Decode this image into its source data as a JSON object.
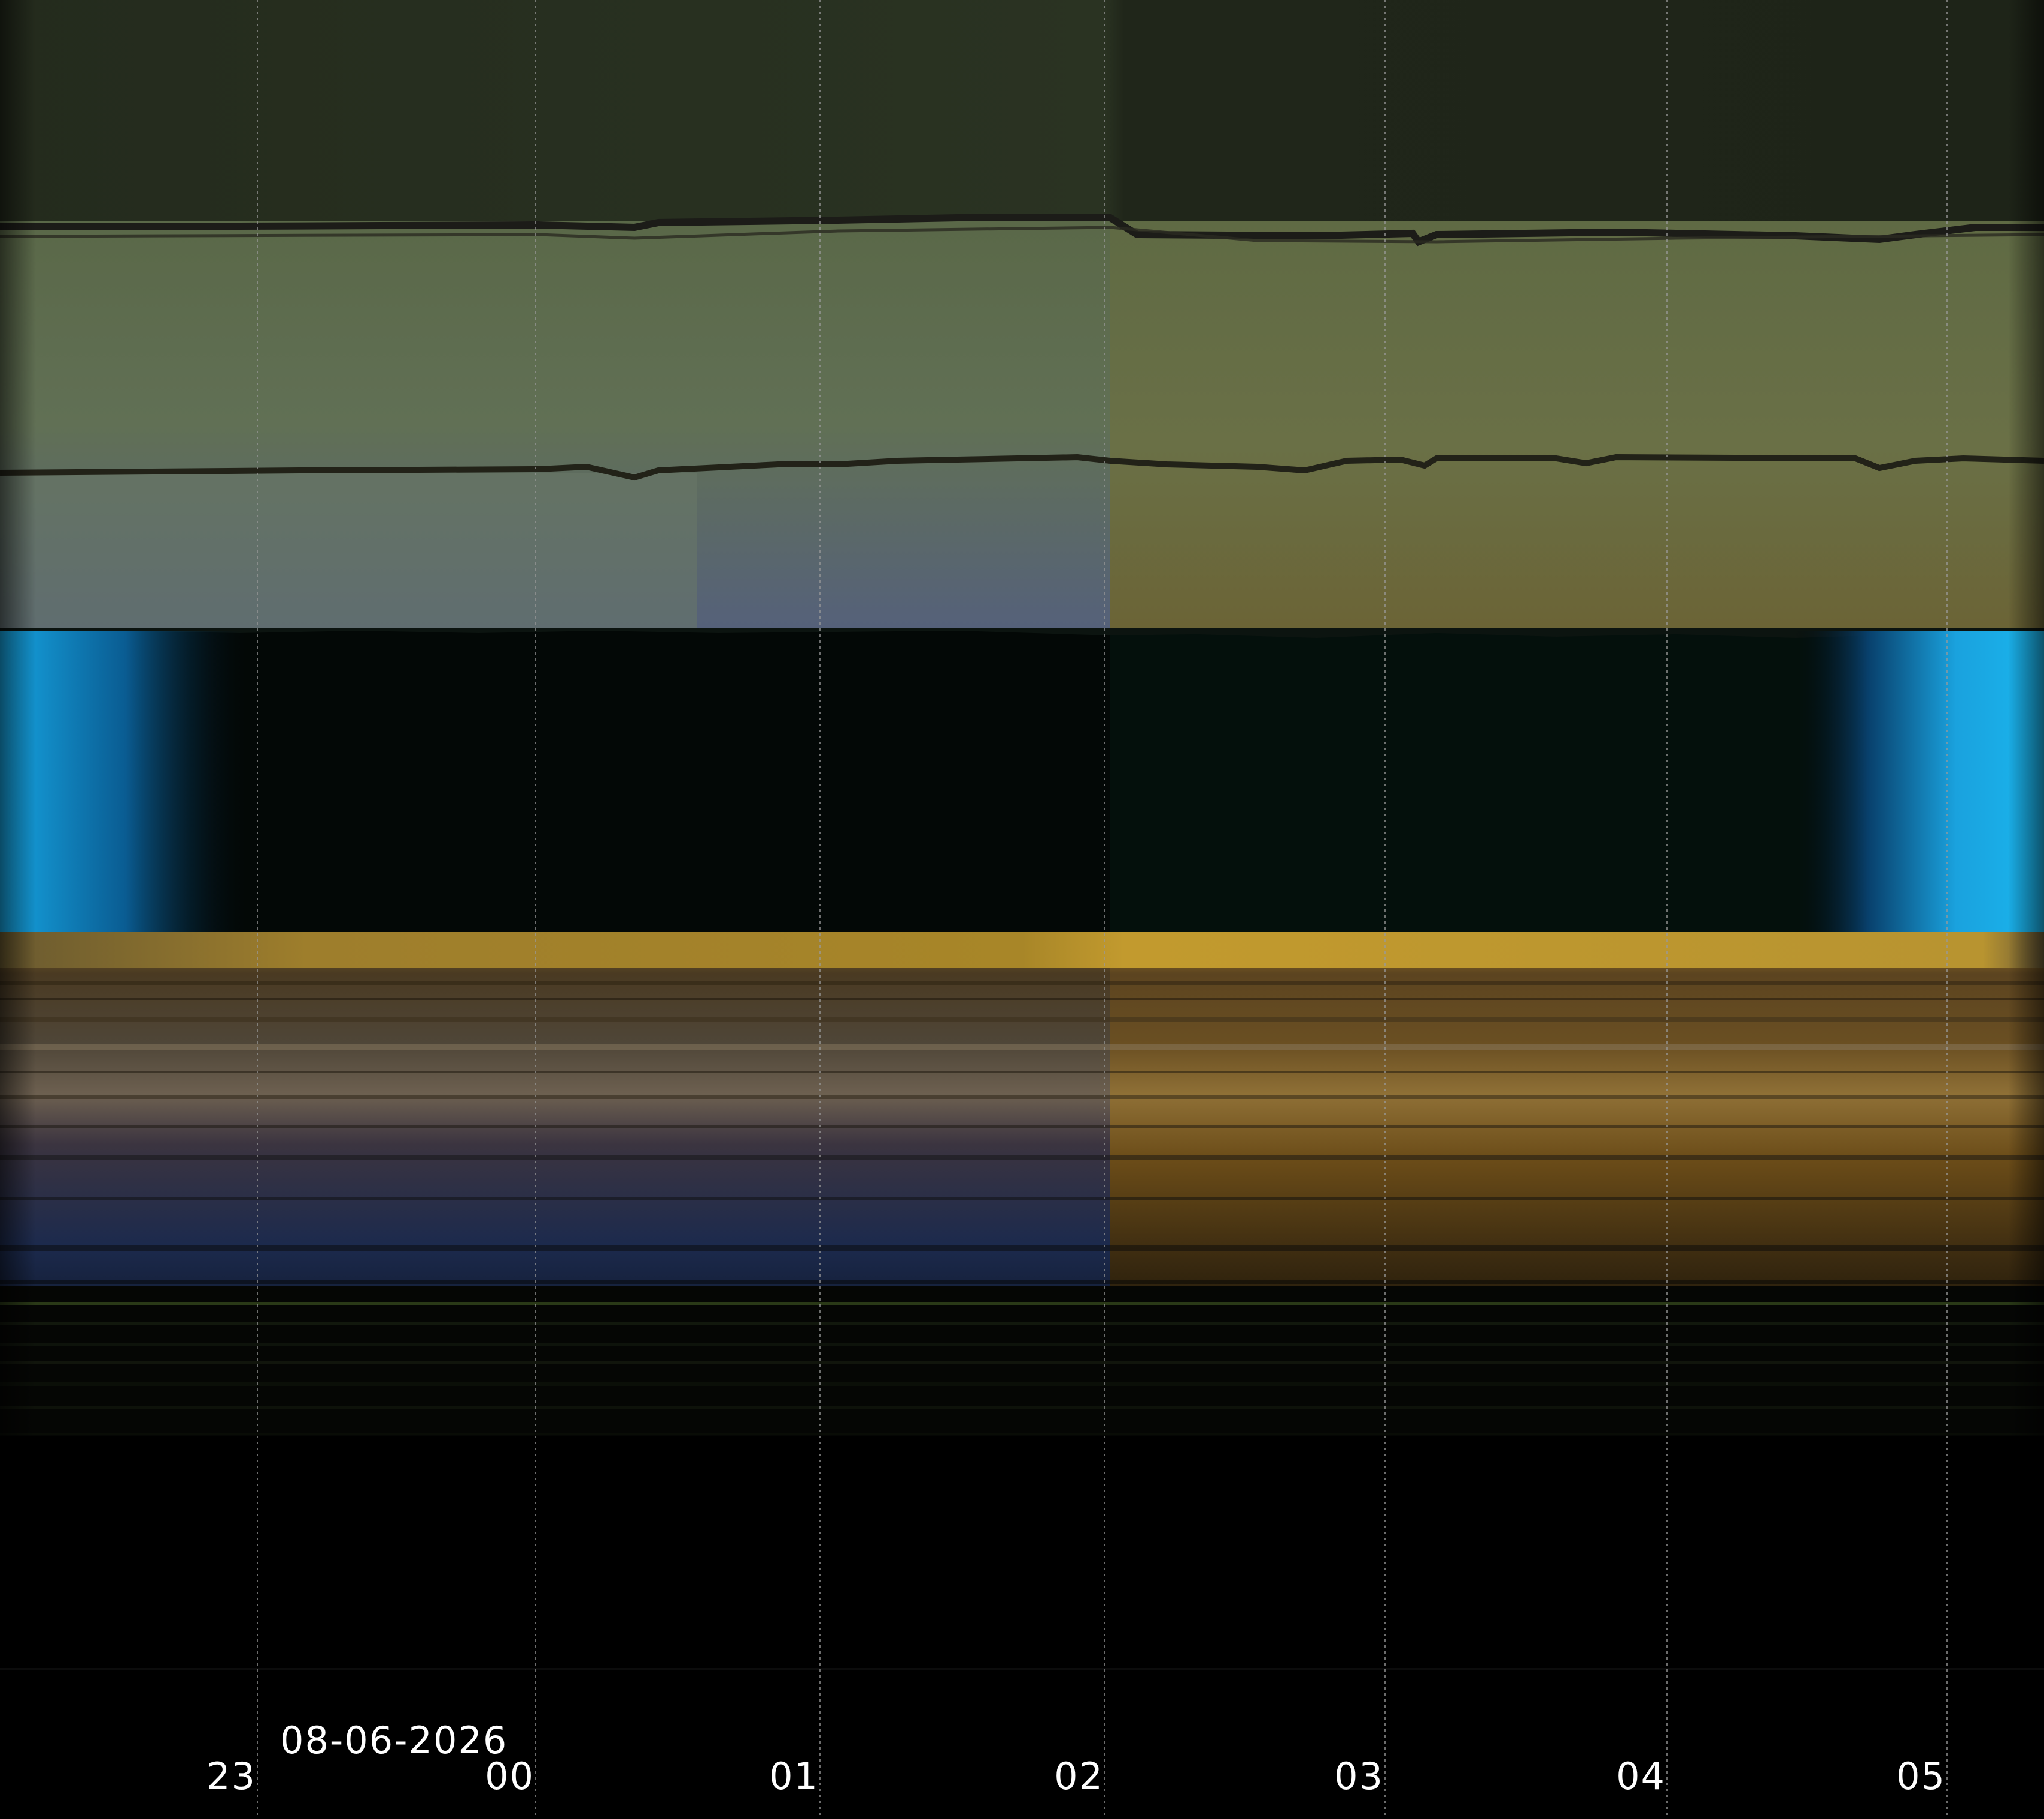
{
  "image": {
    "description_kind": "keogram",
    "date_label": "08-06-2026",
    "time_ticks": [
      "23",
      "00",
      "01",
      "02",
      "03",
      "04",
      "05"
    ]
  },
  "colors": {
    "sky_top": "#20261a",
    "band_olive": "#5b6a46",
    "band_olive_right": "#6b6f3e",
    "band_blue_tint": "#52607a",
    "dark_middle": "#030806",
    "twilight_blue": "#17a6e4",
    "ground_gold": "#b58d2a",
    "ground_brown": "#5a4020",
    "ground_blue": "#1c2a4d",
    "grid_line": "#8a8a8a",
    "text": "#ffffff"
  }
}
